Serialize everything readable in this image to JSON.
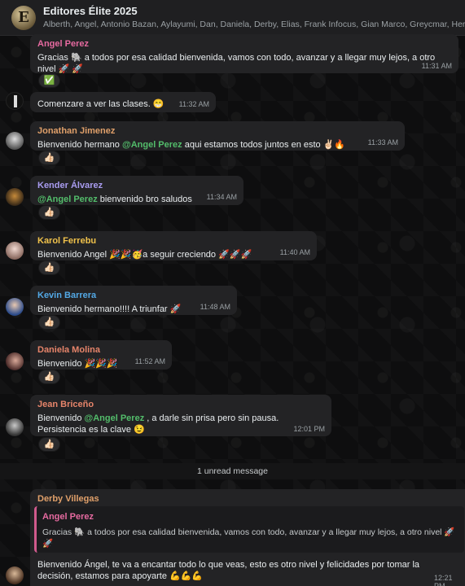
{
  "header": {
    "title": "Editores Élite 2025",
    "members": "Alberth, Angel, Antonio Bazan, Aylayumi, Dan, Daniela, Derby, Elias, Frank Infocus, Gian Marco, Greycmar, Hernan"
  },
  "messages": [
    {
      "sender": "Angel Perez",
      "sender_color": "#e66aa0",
      "line1": "Gracias 🐘 a todos por esa calidad bienvenida, vamos con todo, avanzar y a llegar muy lejos, a otro",
      "line2": "nivel 🚀 🚀",
      "time": "11:31 AM",
      "reaction": "✅"
    },
    {
      "text": "Comenzare a ver las clases. 😁",
      "time": "11:32 AM"
    },
    {
      "sender": "Jonathan Jimenez",
      "sender_color": "#e0a06a",
      "pre": "Bienvenido hermano ",
      "mention": "@Angel Perez",
      "post": " aqui estamos todos juntos en esto ✌🏻🔥",
      "time": "11:33 AM",
      "reaction": "👍🏻"
    },
    {
      "sender": "Kender Álvarez",
      "sender_color": "#a99cf0",
      "pre": "",
      "mention": "@Angel Perez",
      "post": " bienvenido bro saludos",
      "time": "11:34 AM",
      "reaction": "👍🏻"
    },
    {
      "sender": "Karol Ferrebu",
      "sender_color": "#f0c24b",
      "text": "Bienvenido Angel 🎉🎉🥳a seguir creciendo 🚀🚀🚀",
      "time": "11:40 AM",
      "reaction": "👍🏻"
    },
    {
      "sender": "Kevin Barrera",
      "sender_color": "#53a9e6",
      "text": "Bienvenido hermano!!!! A triunfar 🚀",
      "time": "11:48 AM",
      "reaction": "👍🏻"
    },
    {
      "sender": "Daniela Molina",
      "sender_color": "#e6846a",
      "text": "Bienvenido 🎉🎉🎉",
      "time": "11:52 AM",
      "reaction": "👍🏻"
    },
    {
      "sender": "Jean Briceño",
      "sender_color": "#e6846a",
      "pre": "Bienvenido ",
      "mention": "@Angel Perez",
      "post": " , a darle sin prisa pero sin pausa.",
      "line2": "Persistencia es la clave 😉",
      "time": "12:01 PM",
      "reaction": "👍🏻"
    }
  ],
  "unread": "1 unread message",
  "last": {
    "sender": "Derby Villegas",
    "sender_color": "#e0a06a",
    "quote_sender": "Angel Perez",
    "quote_line1": "Gracias 🐘 a todos por esa calidad bienvenida, vamos con todo, avanzar y a llegar muy lejos, a otro nivel 🚀",
    "quote_line2": "🚀",
    "line1": "Bienvenido Ángel, te va a encantar todo lo que veas, esto es otro nivel y felicidades por tomar la",
    "line2": "decisión, estamos para apoyarte 💪💪💪",
    "time": "12:21 PM"
  }
}
